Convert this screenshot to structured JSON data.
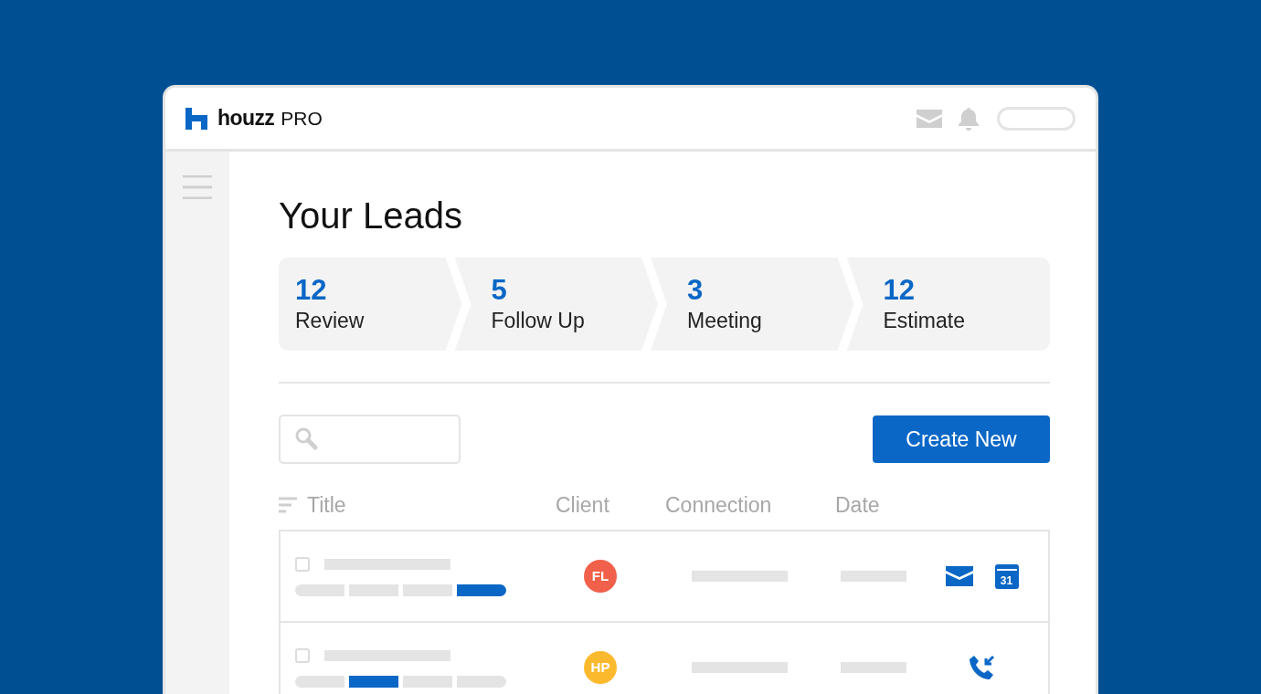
{
  "brand": {
    "name": "houzz",
    "suffix": "PRO"
  },
  "page_title": "Your Leads",
  "stages": [
    {
      "count": "12",
      "label": "Review"
    },
    {
      "count": "5",
      "label": "Follow Up"
    },
    {
      "count": "3",
      "label": "Meeting"
    },
    {
      "count": "12",
      "label": "Estimate"
    }
  ],
  "create_button": "Create New",
  "table": {
    "columns": [
      "Title",
      "Client",
      "Connection",
      "Date"
    ],
    "rows": [
      {
        "checked": false,
        "initials": "FL",
        "color": "#f0604a",
        "tags": [
          {
            "highlighted": false
          },
          {
            "highlighted": false
          },
          {
            "highlighted": false
          },
          {
            "highlighted": true
          }
        ],
        "actions": [
          {
            "kind": "mail"
          },
          {
            "kind": "calendar",
            "text": "31"
          }
        ]
      },
      {
        "checked": false,
        "initials": "HP",
        "color": "#fbba2e",
        "tags": [
          {
            "highlighted": false
          },
          {
            "highlighted": true
          },
          {
            "highlighted": false
          },
          {
            "highlighted": false
          }
        ],
        "actions": [
          {
            "kind": "phone"
          }
        ]
      }
    ]
  }
}
